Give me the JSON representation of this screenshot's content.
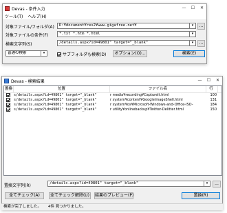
{
  "cond_window": {
    "title": "Devas - 条件入力",
    "menu": [
      "ツール(T)",
      "ヘルプ(H)"
    ],
    "target_folder_label": "対象ファイル/フォルダ(A)",
    "target_folder_value": "D:¥document¥res2¥www.gigafree.net¥",
    "target_cond_label": "対象ファイルの条件(F)",
    "target_cond_value": "*.txt *.htm *.html",
    "search_label": "検索文字列(S)",
    "search_value": "/details.aspx?id=49801\" target=\"_blank\"",
    "mode_value": "普通の検索",
    "subfolder_label": "サブフォルダも検索(D)",
    "subfolder_checked": true,
    "option_button": "オプション(O)...",
    "search_button": "検索(E)",
    "browse_label": "..."
  },
  "result_window": {
    "title": "Devas - 検索結果",
    "columns": [
      "置換",
      "位置",
      "ファイル名",
      "行"
    ],
    "rows": [
      {
        "checked": true,
        "position": "s/details.aspx?id=49801\" target=\"_blank\"",
        "file": "r media¥recording¥CaptureIt.html",
        "line": "100"
      },
      {
        "checked": true,
        "position": "s/details.aspx?id=49801\" target=\"_blank\"",
        "file": "r system¥content¥GoogleImageShell.html",
        "line": "131"
      },
      {
        "checked": true,
        "position": "s/details.aspx?id=49801\" target=\"_blank\"",
        "file": "r system¥os¥Microsoft-Windows-and-Office-ISO-",
        "line": "184"
      },
      {
        "checked": true,
        "position": "s/details.aspx?id=49801\" target=\"_blank\"",
        "file": "r utility¥onlinebackup¥Twitter-Delitter.html",
        "line": "150"
      }
    ],
    "replace_label": "置換文字列(R)",
    "replace_value": "/details.aspx?id=49801\" target=\"_blank\"",
    "btn_check_all": "全てチェック(A)",
    "btn_uncheck_all": "全てチェック解除(U)",
    "btn_preview": "結果のプレビュー(P)",
    "btn_replace": "置換(R)",
    "status_left": "検索が完了しました。",
    "status_right": "4件 見つかりました。"
  }
}
